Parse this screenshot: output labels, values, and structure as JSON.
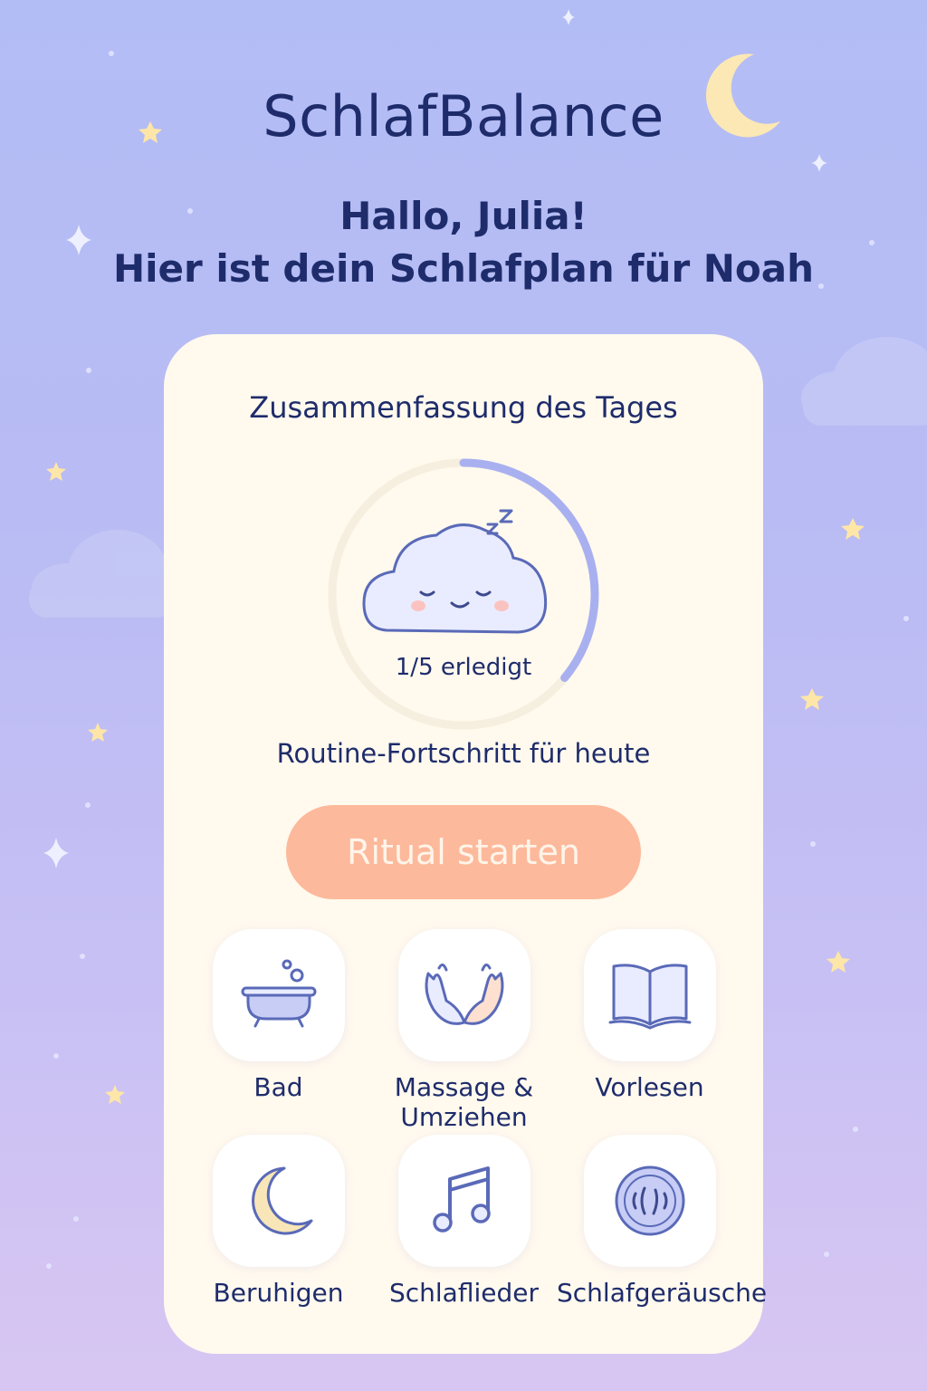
{
  "header": {
    "app_title": "SchlafBalance",
    "greeting_line1": "Hallo, Julia!",
    "greeting_line2": "Hier ist dein Schlafplan für Noah"
  },
  "summary": {
    "title": "Zusammenfassung des Tages",
    "progress_label": "1/5 erledigt",
    "progress_fraction": 0.2,
    "routine_label": "Routine-Fortschritt für heute",
    "start_button": "Ritual starten"
  },
  "activities": [
    {
      "label": "Bad",
      "icon": "bathtub-icon"
    },
    {
      "label": "Massage & Umziehen",
      "icon": "hands-icon"
    },
    {
      "label": "Vorlesen",
      "icon": "book-icon"
    },
    {
      "label": "Beruhigen",
      "icon": "moon-icon"
    },
    {
      "label": "Schlaflieder",
      "icon": "music-note-icon"
    },
    {
      "label": "Schlafgeräusche",
      "icon": "white-noise-icon"
    }
  ],
  "colors": {
    "primary_text": "#1e2c6b",
    "accent_purple": "#a9b0f0",
    "button_peach": "#fdb99b",
    "card_bg": "#fff9ee",
    "moon_yellow": "#fbe8b4"
  }
}
